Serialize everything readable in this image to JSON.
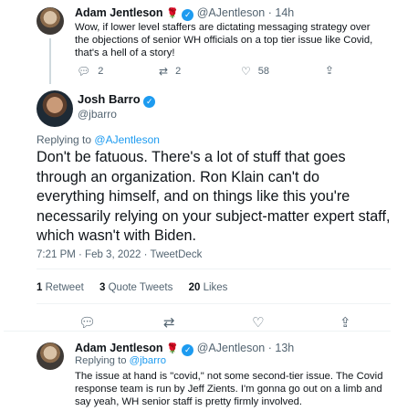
{
  "tweet1": {
    "name": "Adam Jentleson",
    "handle": "@AJentleson",
    "time": "· 14h",
    "text": "Wow, if lower level staffers are dictating messaging strategy over the objections of senior WH officials on a top tier issue like Covid, that's a hell of a story!",
    "replies": "2",
    "retweets": "2",
    "likes": "58"
  },
  "tweet2": {
    "name": "Josh Barro",
    "handle": "@jbarro",
    "replying_label": "Replying to",
    "replying_to": "@AJentleson",
    "text": "Don't be fatuous. There's a lot of stuff that goes through an organization. Ron Klain can't do everything himself, and on things like this you're necessarily relying on your subject-matter expert staff, which wasn't with Biden.",
    "timestamp": "7:21 PM · Feb 3, 2022 · TweetDeck",
    "retweets_count": "1",
    "retweets_label": "Retweet",
    "quotes_count": "3",
    "quotes_label": "Quote Tweets",
    "likes_count": "20",
    "likes_label": "Likes"
  },
  "tweet3": {
    "name": "Adam Jentleson",
    "handle": "@AJentleson",
    "time": "· 13h",
    "replying_label": "Replying to",
    "replying_to": "@jbarro",
    "text": "The issue at hand is \"covid,\" not some second-tier issue. The Covid response team is run by Jeff Zients. I'm gonna go out on a limb and say yeah, WH senior staff is pretty firmly involved."
  },
  "icons": [
    "reply-icon",
    "retweet-icon",
    "like-icon",
    "share-icon",
    "verified-badge-icon",
    "rose-icon"
  ],
  "colors": {
    "accent": "#1d9bf0",
    "muted": "#536471",
    "text": "#0f1419",
    "divider": "#eff3f4",
    "rose": "#c0182a"
  }
}
